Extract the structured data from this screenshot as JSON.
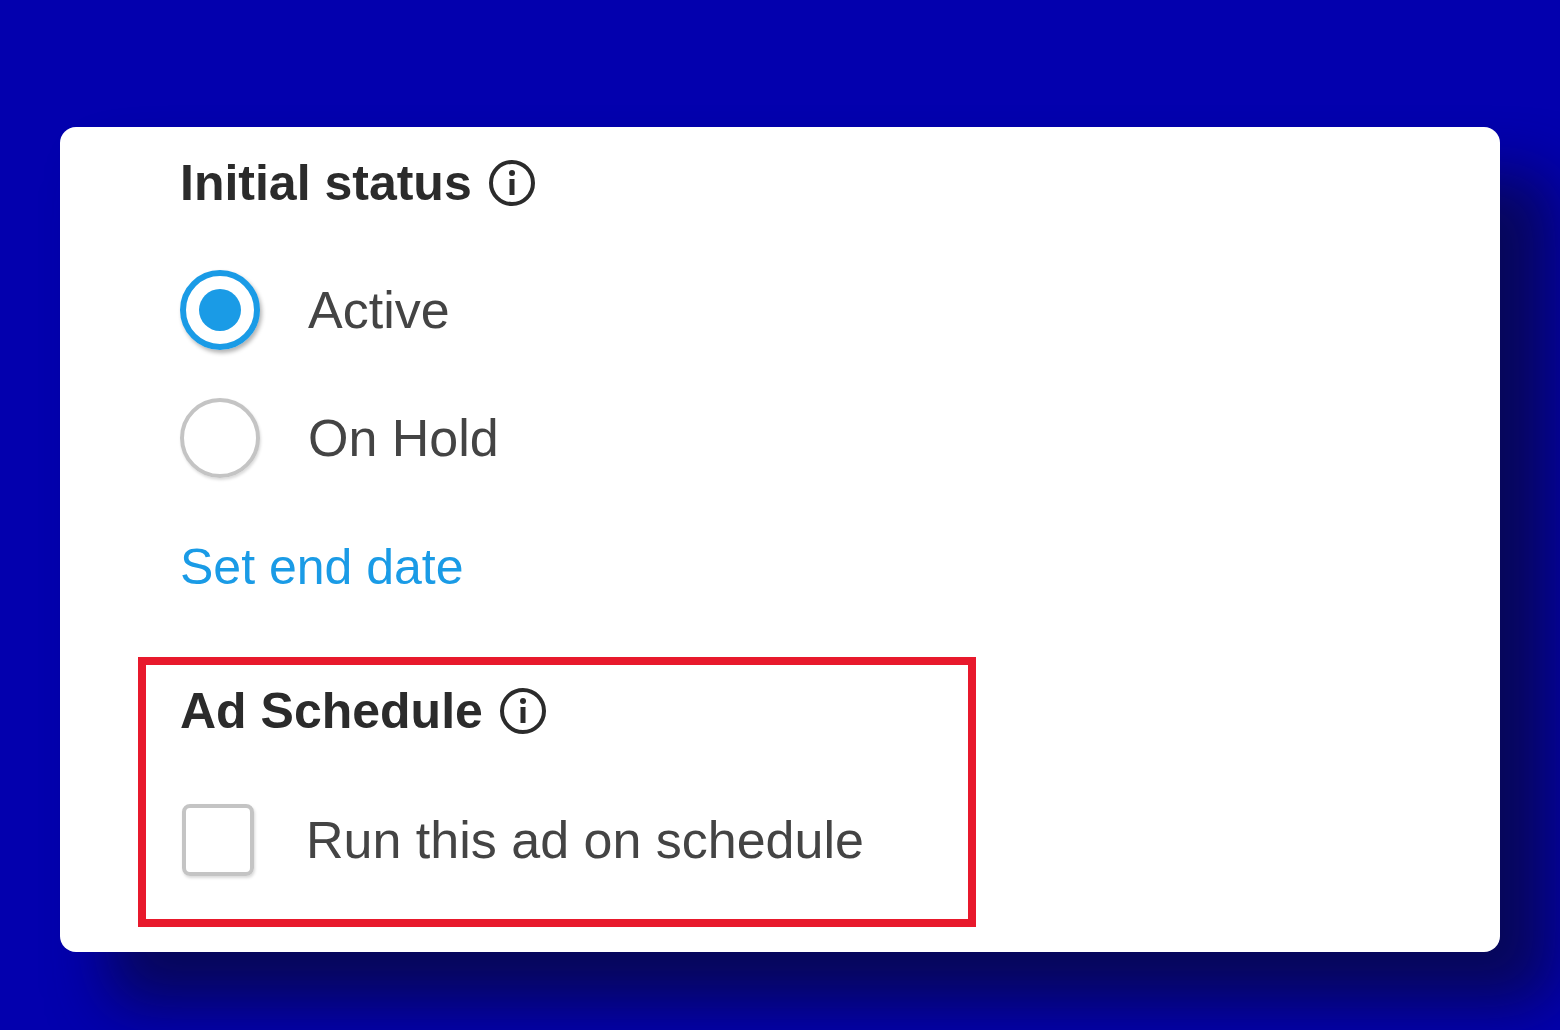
{
  "initial_status": {
    "title": "Initial status",
    "options": [
      {
        "label": "Active",
        "selected": true
      },
      {
        "label": "On Hold",
        "selected": false
      }
    ]
  },
  "end_date_link": "Set end date",
  "ad_schedule": {
    "title": "Ad Schedule",
    "highlighted": true,
    "option": {
      "label": "Run this ad on schedule",
      "checked": false
    }
  }
}
